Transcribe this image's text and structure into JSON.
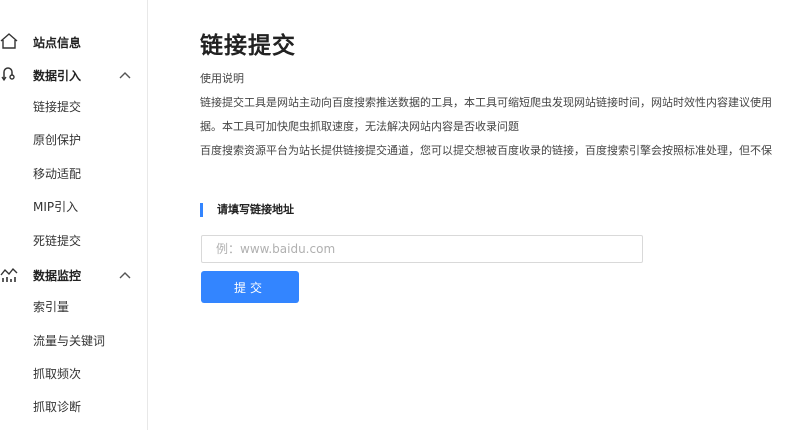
{
  "sidebar": {
    "groups": [
      {
        "label": "站点信息",
        "icon": "home-icon",
        "expanded": null
      },
      {
        "label": "数据引入",
        "icon": "data-import-icon",
        "expanded": true,
        "items": [
          "链接提交",
          "原创保护",
          "移动适配",
          "MIP引入",
          "死链提交"
        ]
      },
      {
        "label": "数据监控",
        "icon": "monitor-chart-icon",
        "expanded": true,
        "items": [
          "索引量",
          "流量与关键词",
          "抓取频次",
          "抓取诊断"
        ]
      }
    ]
  },
  "main": {
    "title": "链接提交",
    "description": [
      "使用说明",
      "链接提交工具是网站主动向百度搜索推送数据的工具，本工具可缩短爬虫发现网站链接时间，网站时效性内容建议使用",
      "据。本工具可加快爬虫抓取速度，无法解决网站内容是否收录问题",
      "百度搜索资源平台为站长提供链接提交通道，您可以提交想被百度收录的链接，百度搜索引擎会按照标准处理，但不保"
    ],
    "section_title": "请填写链接地址",
    "input_placeholder": "例：www.baidu.com",
    "input_value": "",
    "submit_label": "提交"
  },
  "colors": {
    "accent": "#3385ff",
    "border": "#d9d9d9",
    "placeholder": "#b0b0b0"
  }
}
